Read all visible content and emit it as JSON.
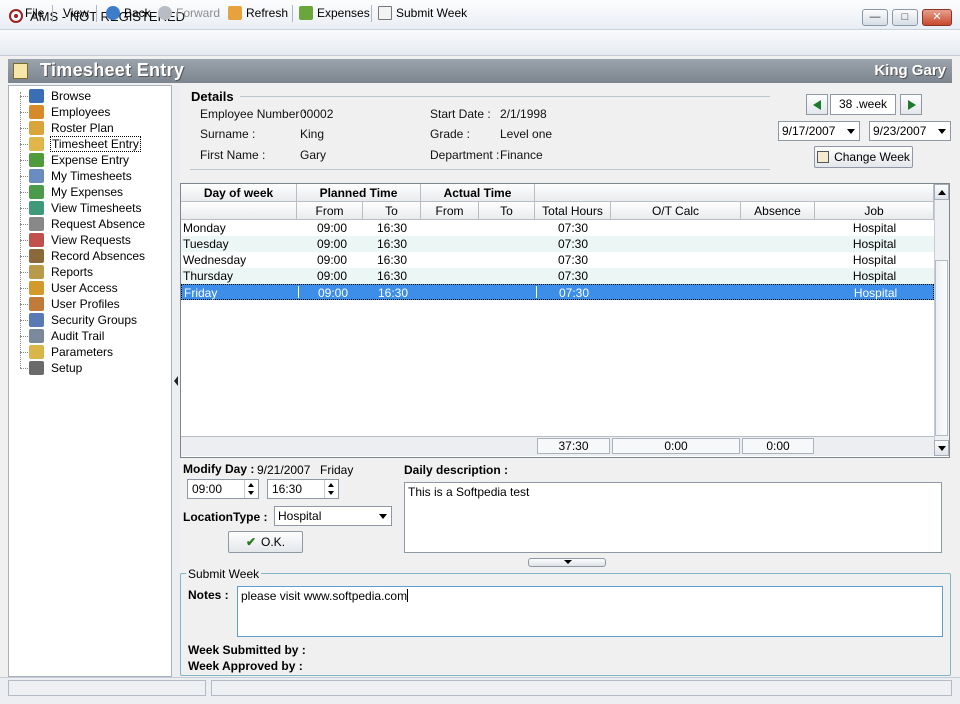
{
  "window": {
    "title": "AMS - NOT REGISTERED",
    "controls": {
      "minimize": "—",
      "maximize": "□",
      "close": "✕"
    }
  },
  "toolbar": {
    "file": "File",
    "view": "View",
    "back": "Back",
    "forward": "Forward",
    "refresh": "Refresh",
    "expenses": "Expenses",
    "submit_week": "Submit Week"
  },
  "header": {
    "title": "Timesheet Entry",
    "user": "King Gary"
  },
  "tree": {
    "items": [
      {
        "label": "Browse",
        "icon": "globe-icon",
        "color": "#3a6fb5"
      },
      {
        "label": "Employees",
        "icon": "users-icon",
        "color": "#d68a2c"
      },
      {
        "label": "Roster Plan",
        "icon": "calendar-icon",
        "color": "#d9a53a"
      },
      {
        "label": "Timesheet Entry",
        "icon": "timesheet-icon",
        "color": "#e0b54a"
      },
      {
        "label": "Expense Entry",
        "icon": "money-icon",
        "color": "#4f9a3a"
      },
      {
        "label": "My Timesheets",
        "icon": "magnifier-icon",
        "color": "#6a8cc0"
      },
      {
        "label": "My Expenses",
        "icon": "expenses-icon",
        "color": "#4a9c4a"
      },
      {
        "label": "View Timesheets",
        "icon": "sheet-icon",
        "color": "#3f9a7a"
      },
      {
        "label": "Request Absence",
        "icon": "hand-icon",
        "color": "#888888"
      },
      {
        "label": "View Requests",
        "icon": "eye-icon",
        "color": "#c0504d"
      },
      {
        "label": "Record Absences",
        "icon": "pen-icon",
        "color": "#8a6a3a"
      },
      {
        "label": "Reports",
        "icon": "reports-icon",
        "color": "#b89a4a"
      },
      {
        "label": "User Access",
        "icon": "key-user-icon",
        "color": "#d09a2c"
      },
      {
        "label": "User Profiles",
        "icon": "profile-icon",
        "color": "#c07a3a"
      },
      {
        "label": "Security Groups",
        "icon": "group-icon",
        "color": "#5a7ab5"
      },
      {
        "label": "Audit Trail",
        "icon": "audit-icon",
        "color": "#7a8a9a"
      },
      {
        "label": "Parameters",
        "icon": "folder-icon",
        "color": "#d9b54a"
      },
      {
        "label": "Setup",
        "icon": "tools-icon",
        "color": "#6a6a6a"
      }
    ]
  },
  "details": {
    "title": "Details",
    "employee_number_label": "Employee Number :",
    "employee_number": "00002",
    "surname_label": "Surname :",
    "surname": "King",
    "first_name_label": "First Name :",
    "first_name": "Gary",
    "start_date_label": "Start Date :",
    "start_date": "2/1/1998",
    "grade_label": "Grade :",
    "grade": "Level one",
    "department_label": "Department :",
    "department": "Finance"
  },
  "week": {
    "week_label": "38 .week",
    "from_date": "9/17/2007",
    "to_date": "9/23/2007",
    "change_week": "Change Week"
  },
  "grid": {
    "group_headers": {
      "day": "Day of week",
      "planned": "Planned Time",
      "actual": "Actual Time"
    },
    "sub_headers": {
      "from": "From",
      "to": "To",
      "total": "Total Hours",
      "ot": "O/T Calc",
      "absence": "Absence",
      "job": "Job"
    },
    "rows": [
      {
        "day": "Monday",
        "pfrom": "09:00",
        "pto": "16:30",
        "afrom": "",
        "ato": "",
        "total": "07:30",
        "ot": "",
        "absence": "",
        "job": "Hospital"
      },
      {
        "day": "Tuesday",
        "pfrom": "09:00",
        "pto": "16:30",
        "afrom": "",
        "ato": "",
        "total": "07:30",
        "ot": "",
        "absence": "",
        "job": "Hospital"
      },
      {
        "day": "Wednesday",
        "pfrom": "09:00",
        "pto": "16:30",
        "afrom": "",
        "ato": "",
        "total": "07:30",
        "ot": "",
        "absence": "",
        "job": "Hospital"
      },
      {
        "day": "Thursday",
        "pfrom": "09:00",
        "pto": "16:30",
        "afrom": "",
        "ato": "",
        "total": "07:30",
        "ot": "",
        "absence": "",
        "job": "Hospital"
      },
      {
        "day": "Friday",
        "pfrom": "09:00",
        "pto": "16:30",
        "afrom": "",
        "ato": "",
        "total": "07:30",
        "ot": "",
        "absence": "",
        "job": "Hospital"
      }
    ],
    "totals": {
      "total": "37:30",
      "ot": "0:00",
      "absence": "0:00"
    }
  },
  "modify": {
    "label": "Modify Day :",
    "date": "9/21/2007",
    "weekday": "Friday",
    "from_time": "09:00",
    "to_time": "16:30",
    "location_label": "LocationType :",
    "location": "Hospital",
    "ok": "O.K.",
    "daily_desc_label": "Daily description :",
    "daily_desc": "This is a Softpedia test"
  },
  "submit": {
    "legend": "Submit Week",
    "notes_label": "Notes :",
    "notes": "please visit www.softpedia.com",
    "submitted_by": "Week Submitted by :",
    "approved_by": "Week Approved by :"
  }
}
